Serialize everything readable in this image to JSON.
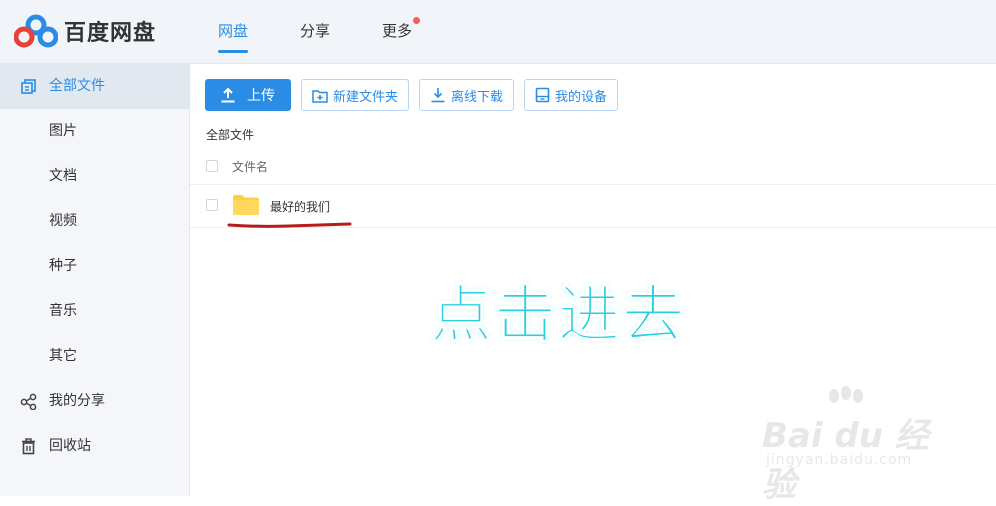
{
  "header": {
    "logo_text": "百度网盘",
    "nav": [
      {
        "label": "网盘",
        "active": true
      },
      {
        "label": "分享",
        "active": false
      },
      {
        "label": "更多",
        "active": false,
        "has_dot": true
      }
    ]
  },
  "sidebar": {
    "items": [
      {
        "label": "全部文件",
        "icon": "copy-icon",
        "active": true
      },
      {
        "label": "图片"
      },
      {
        "label": "文档"
      },
      {
        "label": "视频"
      },
      {
        "label": "种子"
      },
      {
        "label": "音乐"
      },
      {
        "label": "其它"
      },
      {
        "label": "我的分享",
        "icon": "share-icon"
      },
      {
        "label": "回收站",
        "icon": "trash-icon"
      }
    ]
  },
  "toolbar": {
    "upload": "上传",
    "new_folder": "新建文件夹",
    "offline_download": "离线下载",
    "my_devices": "我的设备"
  },
  "breadcrumb": "全部文件",
  "list": {
    "column_name": "文件名",
    "rows": [
      {
        "name": "最好的我们",
        "type": "folder"
      }
    ]
  },
  "annotation": "点击进去",
  "watermark": {
    "brand": "Bai du 经验",
    "url": "jingyan.baidu.com"
  },
  "colors": {
    "accent": "#2a8ce5",
    "annotation": "#27d0e0",
    "folder": "#ffce45",
    "underline": "#b51c1c"
  }
}
